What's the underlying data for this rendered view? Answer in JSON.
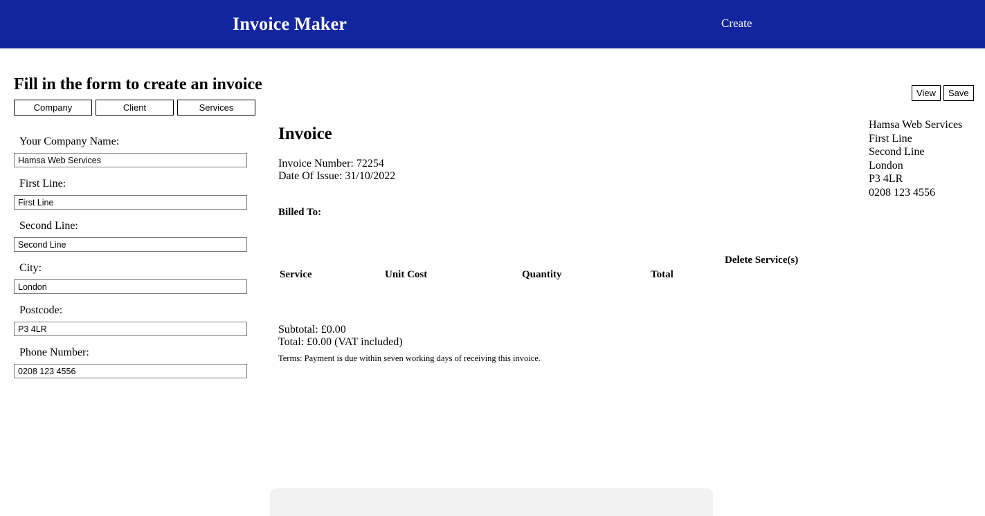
{
  "navbar": {
    "brand": "Invoice Maker",
    "create_link": "Create"
  },
  "page": {
    "heading": "Fill in the form to create an invoice"
  },
  "tabs": [
    {
      "label": "Company",
      "name": "tab-company"
    },
    {
      "label": "Client",
      "name": "tab-client"
    },
    {
      "label": "Services",
      "name": "tab-services"
    }
  ],
  "actions": {
    "view_label": "View",
    "save_label": "Save"
  },
  "form": {
    "fields": [
      {
        "label": "Your Company Name:",
        "value": "Hamsa Web Services",
        "placeholder": "Your Company Name"
      },
      {
        "label": "First Line:",
        "value": "First Line",
        "placeholder": "First Line"
      },
      {
        "label": "Second Line:",
        "value": "Second Line",
        "placeholder": "Second Line"
      },
      {
        "label": "City:",
        "value": "London",
        "placeholder": "City"
      },
      {
        "label": "Postcode:",
        "value": "P3 4LR",
        "placeholder": "Postcode"
      },
      {
        "label": "Phone Number:",
        "value": "0208 123 4556",
        "placeholder": "Phone Number"
      }
    ]
  },
  "invoice": {
    "title": "Invoice",
    "number_line": "Invoice Number: 72254",
    "date_line": "Date Of Issue: 31/10/2022",
    "billed_to_heading": "Billed To:",
    "billed_to_body": "",
    "table": {
      "columns": [
        "Service",
        "Unit Cost",
        "Quantity",
        "Total",
        "Delete Service(s)"
      ],
      "rows": []
    },
    "subtotal_line": "Subtotal: £0.00",
    "total_line": "Total: £0.00 (VAT included)",
    "terms_line": "Terms: Payment is due within seven working days of receiving this invoice."
  },
  "company_address": {
    "lines": [
      "Hamsa Web Services",
      "First Line",
      "Second Line",
      "London",
      "P3 4LR",
      "0208 123 4556"
    ]
  },
  "colors": {
    "navbar_background": "#12249e",
    "navbar_text": "#ffffff",
    "page_background": "#ffffff",
    "body_text": "#000000",
    "input_border": "#767676",
    "button_border": "#000000",
    "footer_slab": "#f2f2f3"
  }
}
